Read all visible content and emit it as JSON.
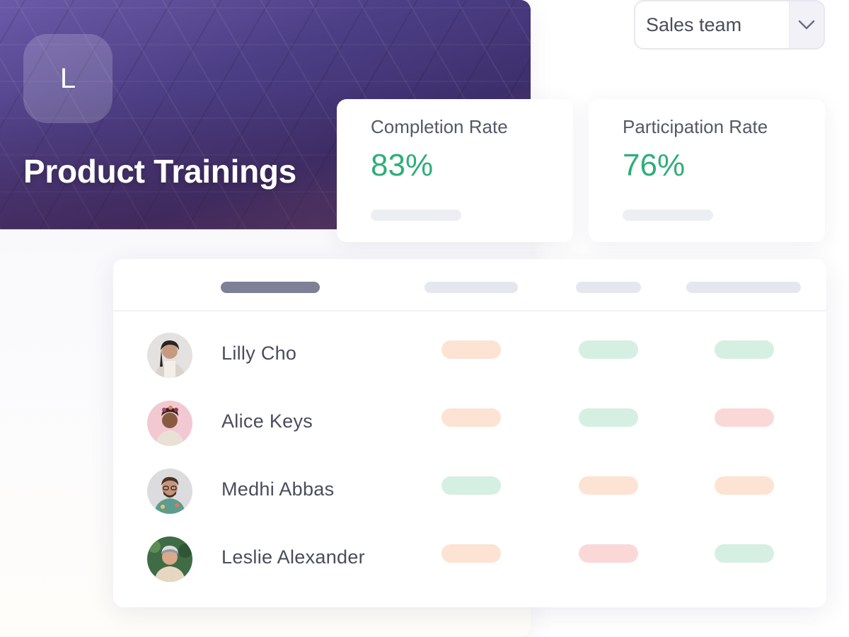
{
  "banner": {
    "logo_letter": "L",
    "title": "Product Trainings"
  },
  "team_select": {
    "value": "Sales team",
    "toggle_icon": "chevron-down-icon"
  },
  "stats": [
    {
      "label": "Completion Rate",
      "value": "83%",
      "color": "#2fae7a"
    },
    {
      "label": "Participation Rate",
      "value": "76%",
      "color": "#2fae7a"
    }
  ],
  "status_colors": {
    "orange": "#fde3d3",
    "green": "#d6efe3",
    "red": "#fbd8d8"
  },
  "table": {
    "rows": [
      {
        "name": "Lilly Cho",
        "statuses": [
          "orange",
          "green",
          "green"
        ]
      },
      {
        "name": "Alice Keys",
        "statuses": [
          "orange",
          "green",
          "red"
        ]
      },
      {
        "name": "Medhi Abbas",
        "statuses": [
          "green",
          "orange",
          "orange"
        ]
      },
      {
        "name": "Leslie Alexander",
        "statuses": [
          "orange",
          "red",
          "green"
        ]
      }
    ]
  }
}
